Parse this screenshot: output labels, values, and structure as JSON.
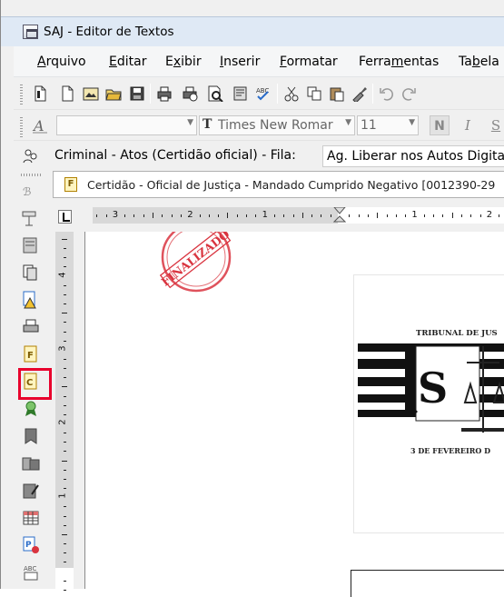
{
  "window": {
    "title": "SAJ - Editor de Textos"
  },
  "menu": [
    {
      "id": "arquivo",
      "label": "Arquivo",
      "ul": "A",
      "rest": "rquivo"
    },
    {
      "id": "editar",
      "label": "Editar",
      "ul": "E",
      "rest": "ditar"
    },
    {
      "id": "exibir",
      "label": "Exibir",
      "pre": "E",
      "ul": "x",
      "rest": "ibir"
    },
    {
      "id": "inserir",
      "label": "Inserir",
      "ul": "I",
      "rest": "nserir"
    },
    {
      "id": "formatar",
      "label": "Formatar",
      "ul": "F",
      "rest": "ormatar"
    },
    {
      "id": "ferramentas",
      "label": "Ferramentas",
      "pre": "Ferra",
      "ul": "m",
      "rest": "entas"
    },
    {
      "id": "tabela",
      "label": "Tabela",
      "pre": "Ta",
      "ul": "b",
      "rest": "ela"
    }
  ],
  "format_bar": {
    "style_value": "",
    "font_value": "Times New Romar",
    "size_value": "11",
    "bold_label": "N",
    "italic_label": "I",
    "underline_label": "S"
  },
  "info_bar": {
    "context_text": "Criminal - Atos (Certidão oficial) - Fila:",
    "queue_value": "Ag. Liberar nos Autos Digitais"
  },
  "document_tab": {
    "icon_letter": "F",
    "title": "Certidão - Oficial de Justiça - Mandado Cumprido Negativo [0012390-29"
  },
  "ruler": {
    "h_labels": [
      "3",
      "2",
      "1",
      "1",
      "2"
    ],
    "v_labels": [
      "4",
      "3",
      "2",
      "1"
    ]
  },
  "document": {
    "stamp_text": "FINALIZADO",
    "header_line1": "TRIBUNAL DE JUS",
    "header_line2": "3 DE FEVEREIRO D",
    "seal_letter": "S"
  },
  "sidebar_icons": [
    "doc-layout-icon",
    "copy-doc-icon",
    "warning-doc-icon",
    "printer-icon",
    "f-doc-icon",
    "c-doc-icon",
    "award-icon",
    "bookmark-icon",
    "puzzle-icon",
    "edit-doc-icon",
    "table-icon",
    "p-doc-icon",
    "abc-icon"
  ],
  "colors": {
    "highlight": "#e8002c",
    "stamp": "#d9343f"
  }
}
